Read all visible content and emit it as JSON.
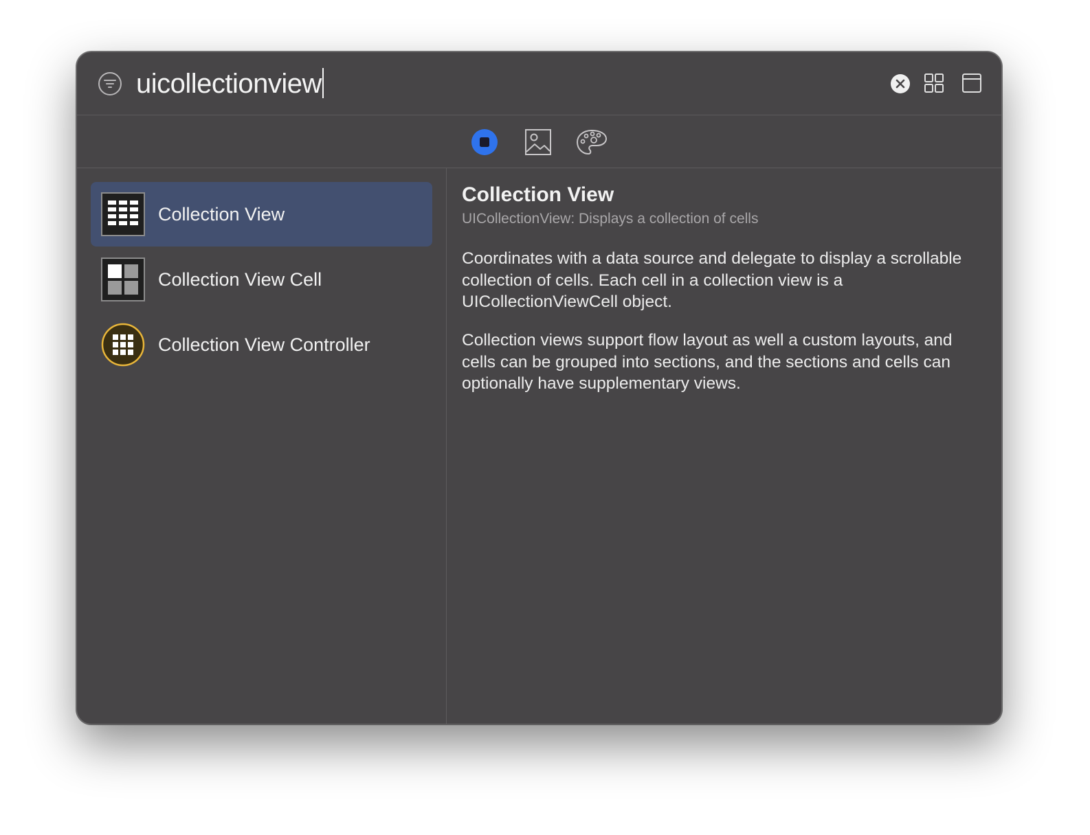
{
  "search": {
    "query": "uicollectionview"
  },
  "segments": [
    "objects-icon",
    "media-icon",
    "colors-icon"
  ],
  "colors": {
    "window_background": "#474547",
    "selection": "#435070",
    "accent": "#2f73ec",
    "controller_icon": "#e9b63a"
  },
  "list": {
    "items": [
      {
        "label": "Collection View",
        "icon": "collection-view-icon",
        "selected": true
      },
      {
        "label": "Collection View Cell",
        "icon": "collection-view-cell-icon",
        "selected": false
      },
      {
        "label": "Collection View Controller",
        "icon": "collection-view-controller-icon",
        "selected": false
      }
    ]
  },
  "detail": {
    "title": "Collection View",
    "subtitle": "UICollectionView: Displays a collection of cells",
    "paragraphs": [
      "Coordinates with a data source and delegate to display a scrollable collection of cells. Each cell in a collection view is a UICollectionViewCell object.",
      "Collection views support flow layout as well a custom layouts, and cells can be grouped into sections, and the sections and cells can optionally have supplementary views."
    ]
  }
}
